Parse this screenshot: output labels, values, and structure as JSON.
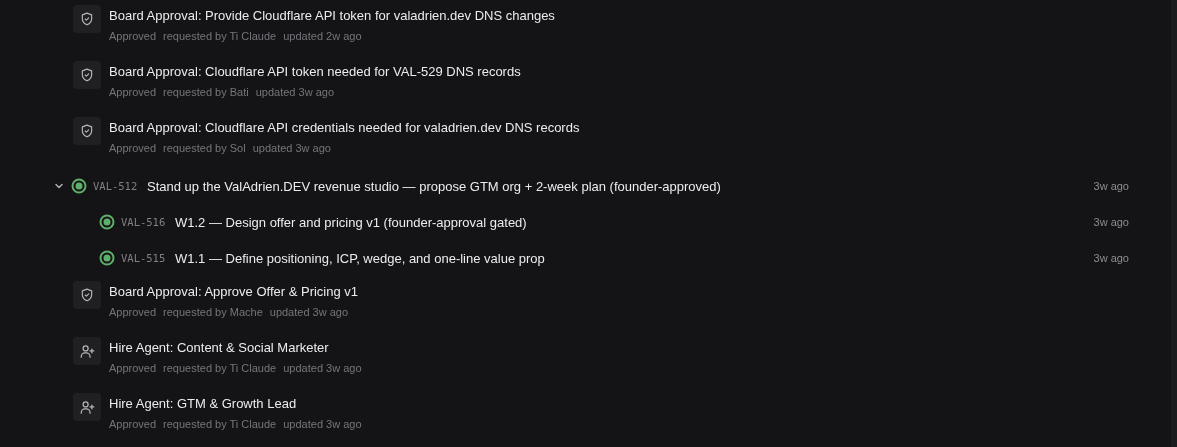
{
  "items": [
    {
      "kind": "approval",
      "title": "Board Approval: Provide Cloudflare API token for valadrien.dev DNS changes",
      "status": "Approved",
      "requested_by": "requested by Ti Claude",
      "updated": "updated 2w ago"
    },
    {
      "kind": "approval",
      "title": "Board Approval: Cloudflare API token needed for VAL-529 DNS records",
      "status": "Approved",
      "requested_by": "requested by Bati",
      "updated": "updated 3w ago"
    },
    {
      "kind": "approval",
      "title": "Board Approval: Cloudflare API credentials needed for valadrien.dev DNS records",
      "status": "Approved",
      "requested_by": "requested by Sol",
      "updated": "updated 3w ago"
    },
    {
      "kind": "issue",
      "expanded": true,
      "color": "#5fae6a",
      "id": "VAL-512",
      "title": "Stand up the ValAdrien.DEV revenue studio — propose GTM org + 2-week plan (founder-approved)",
      "time": "3w ago",
      "children": [
        {
          "color": "#5fae6a",
          "id": "VAL-516",
          "title": "W1.2 — Design offer and pricing v1 (founder-approval gated)",
          "time": "3w ago"
        },
        {
          "color": "#5fae6a",
          "id": "VAL-515",
          "title": "W1.1 — Define positioning, ICP, wedge, and one-line value prop",
          "time": "3w ago"
        }
      ]
    },
    {
      "kind": "approval",
      "title": "Board Approval: Approve Offer & Pricing v1",
      "status": "Approved",
      "requested_by": "requested by Mache",
      "updated": "updated 3w ago"
    },
    {
      "kind": "hire",
      "title": "Hire Agent: Content & Social Marketer",
      "status": "Approved",
      "requested_by": "requested by Ti Claude",
      "updated": "updated 3w ago"
    },
    {
      "kind": "hire",
      "title": "Hire Agent: GTM & Growth Lead",
      "status": "Approved",
      "requested_by": "requested by Ti Claude",
      "updated": "updated 3w ago"
    }
  ]
}
